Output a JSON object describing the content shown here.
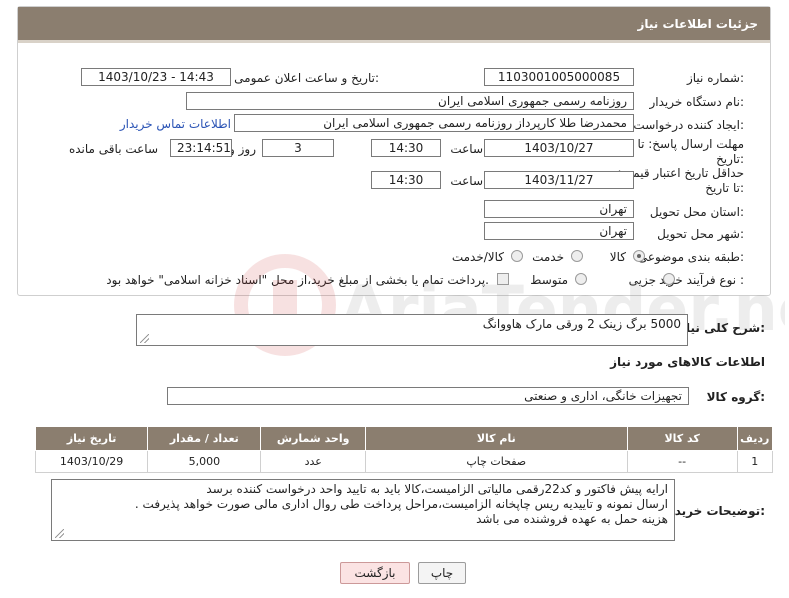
{
  "panel": {
    "title": "جزئیات اطلاعات نیاز"
  },
  "form": {
    "need_number_label": "شماره نیاز:",
    "need_number": "1103001005000085",
    "announce_label": "تاریخ و ساعت اعلان عمومی:",
    "announce_value": "1403/10/23 - 14:43",
    "buyer_org_label": "نام دستگاه خریدار:",
    "buyer_org": "روزنامه رسمی جمهوری اسلامی ایران",
    "creator_label": "ایجاد کننده درخواست:",
    "creator": "محمدرضا طلا کارپرداز روزنامه رسمی جمهوری اسلامی ایران",
    "buyer_contact_link": "اطلاعات تماس خریدار",
    "reply_deadline_label": "مهلت ارسال پاسخ: تا تاریخ:",
    "reply_date": "1403/10/27",
    "time_label": "ساعت",
    "reply_time": "14:30",
    "days_value": "3",
    "days_label": "روز و",
    "remaining_time": "23:14:51",
    "remaining_label": "ساعت باقی مانده",
    "price_validity_label": "حداقل تاریخ اعتبار قیمت: تا تاریخ:",
    "price_date": "1403/11/27",
    "price_time": "14:30",
    "province_label": "استان محل تحویل:",
    "province": "تهران",
    "city_label": "شهر محل تحویل:",
    "city": "تهران",
    "category_label": "طبقه بندی موضوعی:",
    "category_options": [
      "کالا",
      "خدمت",
      "کالا/خدمت"
    ],
    "process_label": "نوع فرآیند خرید :",
    "process_options": [
      "جزیی",
      "متوسط"
    ],
    "payment_note": "پرداخت تمام یا بخشی از مبلغ خرید،از محل \"اسناد خزانه اسلامی\" خواهد بود."
  },
  "description": {
    "label": "شرح کلی نیاز:",
    "value": "5000 برگ زینک 2 ورقی مارک هاووانگ"
  },
  "goods_info_title": "اطلاعات کالاهای مورد نیاز",
  "goods_group": {
    "label": "گروه کالا:",
    "value": "تجهیزات خانگی، اداری و صنعتی"
  },
  "table": {
    "headers": [
      "ردیف",
      "کد کالا",
      "نام کالا",
      "واحد شمارش",
      "تعداد / مقدار",
      "تاریخ نیاز"
    ],
    "rows": [
      [
        "1",
        "--",
        "صفحات چاپ",
        "عدد",
        "5,000",
        "1403/10/29"
      ]
    ]
  },
  "buyer_notes": {
    "label": "توضیحات خریدار:",
    "lines": [
      "ارایه پیش فاکتور و کد22رقمی مالیاتی الزامیست،کالا باید به تایید واحد درخواست کننده برسد",
      "ارسال نمونه و تاییدیه ریس چاپخانه الزامیست،مراحل پرداخت طی روال اداری مالی صورت خواهد پذیرفت .",
      "هزینه حمل به عهده فروشنده می باشد"
    ]
  },
  "buttons": {
    "print": "چاپ",
    "back": "بازگشت"
  },
  "watermark": {
    "text": "AriaTender.neT"
  },
  "colors": {
    "header_bg": "#8b7e6f",
    "link": "#2a53b5"
  }
}
